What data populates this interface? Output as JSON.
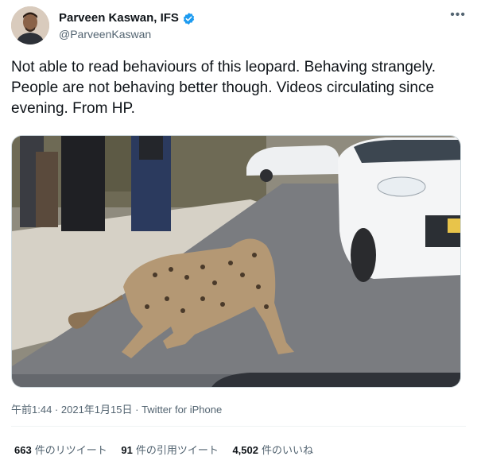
{
  "tweet": {
    "author": {
      "display_name": "Parveen Kaswan, IFS",
      "handle": "@ParveenKaswan",
      "verified_icon": "verified-badge-icon"
    },
    "more_label": "•••",
    "text": "Not able to read behaviours of this leopard. Behaving strangely. People are not behaving better though. Videos circulating since evening. From HP.",
    "meta": {
      "time": "午前1:44",
      "separator": " · ",
      "date": "2021年1月15日",
      "source": "Twitter for iPhone"
    },
    "stats": [
      {
        "count": "663",
        "label": "件のリツイート"
      },
      {
        "count": "91",
        "label": "件の引用ツイート"
      },
      {
        "count": "4,502",
        "label": "件のいいね"
      }
    ]
  },
  "colors": {
    "text_primary": "#0f1419",
    "text_secondary": "#536471",
    "verified_blue": "#1d9bf0",
    "border": "#cfd9de"
  }
}
